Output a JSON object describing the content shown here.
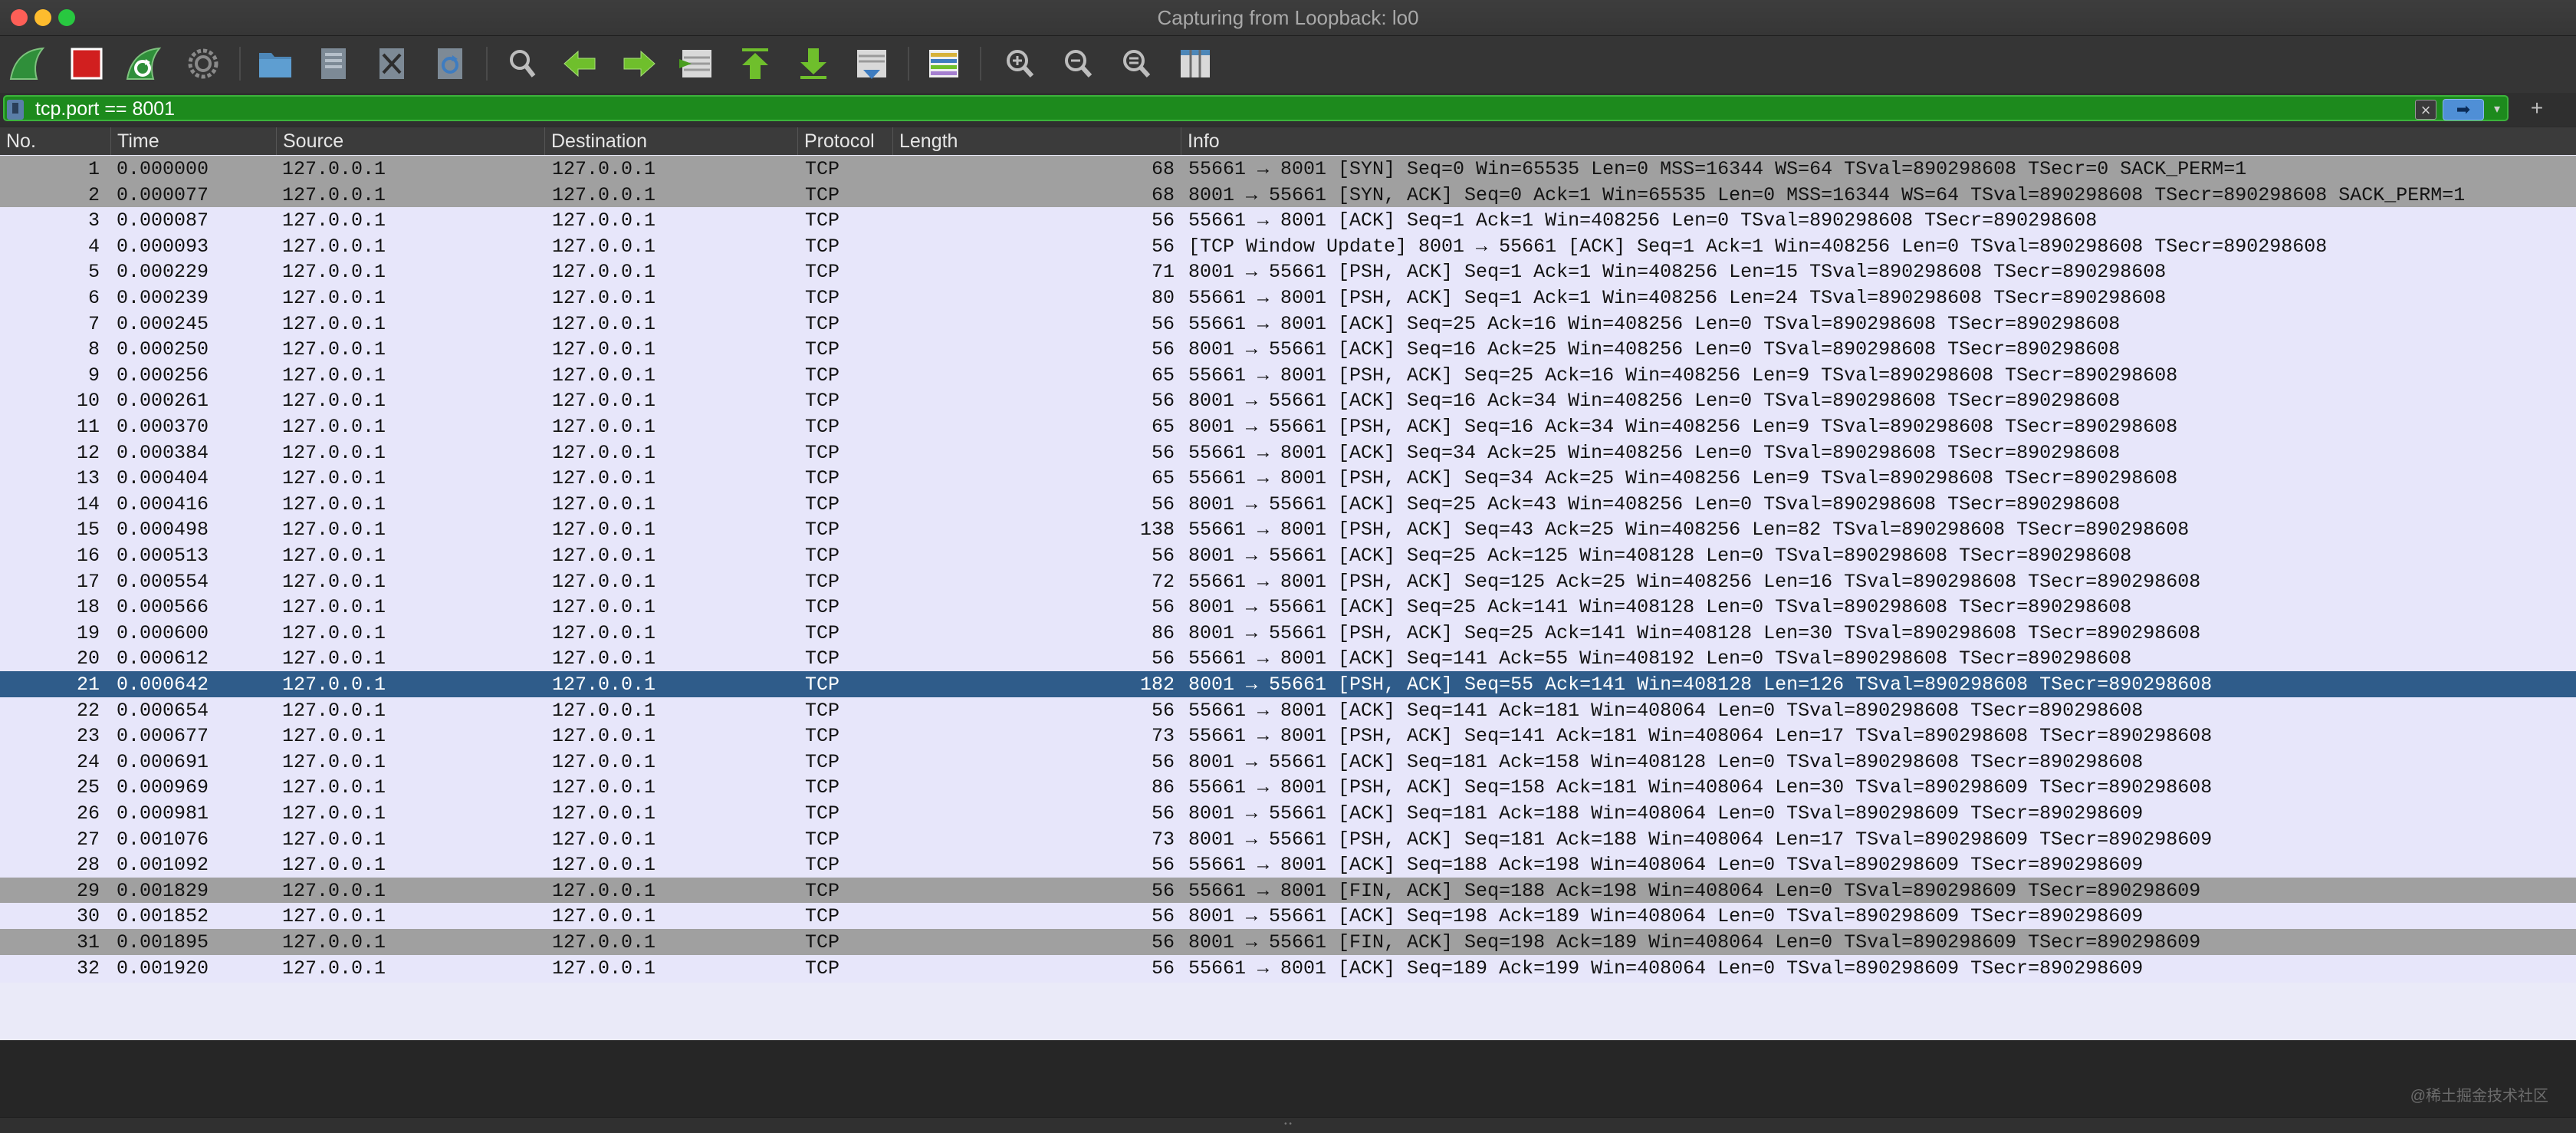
{
  "window": {
    "title": "Capturing from Loopback: lo0"
  },
  "toolbar": {
    "icons": [
      "shark-fin-start-icon",
      "stop-square-icon",
      "restart-fin-icon",
      "gear-icon",
      "folder-open-icon",
      "file-save-icon",
      "file-close-icon",
      "reload-icon",
      "find-icon",
      "back-arrow-icon",
      "forward-arrow-icon",
      "go-to-packet-icon",
      "first-packet-icon",
      "last-packet-icon",
      "autoscroll-icon",
      "colorize-icon",
      "zoom-in-icon",
      "zoom-out-icon",
      "zoom-reset-icon",
      "resize-columns-icon"
    ]
  },
  "filter": {
    "value": "tcp.port == 8001"
  },
  "columns": {
    "no": "No.",
    "time": "Time",
    "source": "Source",
    "destination": "Destination",
    "protocol": "Protocol",
    "length": "Length",
    "info": "Info"
  },
  "packets": [
    {
      "no": "1",
      "time": "0.000000",
      "src": "127.0.0.1",
      "dst": "127.0.0.1",
      "proto": "TCP",
      "len": "68",
      "info": "55661 → 8001 [SYN] Seq=0 Win=65535 Len=0 MSS=16344 WS=64 TSval=890298608 TSecr=0 SACK_PERM=1",
      "style": "gray"
    },
    {
      "no": "2",
      "time": "0.000077",
      "src": "127.0.0.1",
      "dst": "127.0.0.1",
      "proto": "TCP",
      "len": "68",
      "info": "8001 → 55661 [SYN, ACK] Seq=0 Ack=1 Win=65535 Len=0 MSS=16344 WS=64 TSval=890298608 TSecr=890298608 SACK_PERM=1",
      "style": "gray"
    },
    {
      "no": "3",
      "time": "0.000087",
      "src": "127.0.0.1",
      "dst": "127.0.0.1",
      "proto": "TCP",
      "len": "56",
      "info": "55661 → 8001 [ACK] Seq=1 Ack=1 Win=408256 Len=0 TSval=890298608 TSecr=890298608",
      "style": "normal"
    },
    {
      "no": "4",
      "time": "0.000093",
      "src": "127.0.0.1",
      "dst": "127.0.0.1",
      "proto": "TCP",
      "len": "56",
      "info": "[TCP Window Update] 8001 → 55661 [ACK] Seq=1 Ack=1 Win=408256 Len=0 TSval=890298608 TSecr=890298608",
      "style": "normal"
    },
    {
      "no": "5",
      "time": "0.000229",
      "src": "127.0.0.1",
      "dst": "127.0.0.1",
      "proto": "TCP",
      "len": "71",
      "info": "8001 → 55661 [PSH, ACK] Seq=1 Ack=1 Win=408256 Len=15 TSval=890298608 TSecr=890298608",
      "style": "normal"
    },
    {
      "no": "6",
      "time": "0.000239",
      "src": "127.0.0.1",
      "dst": "127.0.0.1",
      "proto": "TCP",
      "len": "80",
      "info": "55661 → 8001 [PSH, ACK] Seq=1 Ack=1 Win=408256 Len=24 TSval=890298608 TSecr=890298608",
      "style": "normal"
    },
    {
      "no": "7",
      "time": "0.000245",
      "src": "127.0.0.1",
      "dst": "127.0.0.1",
      "proto": "TCP",
      "len": "56",
      "info": "55661 → 8001 [ACK] Seq=25 Ack=16 Win=408256 Len=0 TSval=890298608 TSecr=890298608",
      "style": "normal"
    },
    {
      "no": "8",
      "time": "0.000250",
      "src": "127.0.0.1",
      "dst": "127.0.0.1",
      "proto": "TCP",
      "len": "56",
      "info": "8001 → 55661 [ACK] Seq=16 Ack=25 Win=408256 Len=0 TSval=890298608 TSecr=890298608",
      "style": "normal"
    },
    {
      "no": "9",
      "time": "0.000256",
      "src": "127.0.0.1",
      "dst": "127.0.0.1",
      "proto": "TCP",
      "len": "65",
      "info": "55661 → 8001 [PSH, ACK] Seq=25 Ack=16 Win=408256 Len=9 TSval=890298608 TSecr=890298608",
      "style": "normal"
    },
    {
      "no": "10",
      "time": "0.000261",
      "src": "127.0.0.1",
      "dst": "127.0.0.1",
      "proto": "TCP",
      "len": "56",
      "info": "8001 → 55661 [ACK] Seq=16 Ack=34 Win=408256 Len=0 TSval=890298608 TSecr=890298608",
      "style": "normal"
    },
    {
      "no": "11",
      "time": "0.000370",
      "src": "127.0.0.1",
      "dst": "127.0.0.1",
      "proto": "TCP",
      "len": "65",
      "info": "8001 → 55661 [PSH, ACK] Seq=16 Ack=34 Win=408256 Len=9 TSval=890298608 TSecr=890298608",
      "style": "normal"
    },
    {
      "no": "12",
      "time": "0.000384",
      "src": "127.0.0.1",
      "dst": "127.0.0.1",
      "proto": "TCP",
      "len": "56",
      "info": "55661 → 8001 [ACK] Seq=34 Ack=25 Win=408256 Len=0 TSval=890298608 TSecr=890298608",
      "style": "normal"
    },
    {
      "no": "13",
      "time": "0.000404",
      "src": "127.0.0.1",
      "dst": "127.0.0.1",
      "proto": "TCP",
      "len": "65",
      "info": "55661 → 8001 [PSH, ACK] Seq=34 Ack=25 Win=408256 Len=9 TSval=890298608 TSecr=890298608",
      "style": "normal"
    },
    {
      "no": "14",
      "time": "0.000416",
      "src": "127.0.0.1",
      "dst": "127.0.0.1",
      "proto": "TCP",
      "len": "56",
      "info": "8001 → 55661 [ACK] Seq=25 Ack=43 Win=408256 Len=0 TSval=890298608 TSecr=890298608",
      "style": "normal"
    },
    {
      "no": "15",
      "time": "0.000498",
      "src": "127.0.0.1",
      "dst": "127.0.0.1",
      "proto": "TCP",
      "len": "138",
      "info": "55661 → 8001 [PSH, ACK] Seq=43 Ack=25 Win=408256 Len=82 TSval=890298608 TSecr=890298608",
      "style": "normal"
    },
    {
      "no": "16",
      "time": "0.000513",
      "src": "127.0.0.1",
      "dst": "127.0.0.1",
      "proto": "TCP",
      "len": "56",
      "info": "8001 → 55661 [ACK] Seq=25 Ack=125 Win=408128 Len=0 TSval=890298608 TSecr=890298608",
      "style": "normal"
    },
    {
      "no": "17",
      "time": "0.000554",
      "src": "127.0.0.1",
      "dst": "127.0.0.1",
      "proto": "TCP",
      "len": "72",
      "info": "55661 → 8001 [PSH, ACK] Seq=125 Ack=25 Win=408256 Len=16 TSval=890298608 TSecr=890298608",
      "style": "normal"
    },
    {
      "no": "18",
      "time": "0.000566",
      "src": "127.0.0.1",
      "dst": "127.0.0.1",
      "proto": "TCP",
      "len": "56",
      "info": "8001 → 55661 [ACK] Seq=25 Ack=141 Win=408128 Len=0 TSval=890298608 TSecr=890298608",
      "style": "normal"
    },
    {
      "no": "19",
      "time": "0.000600",
      "src": "127.0.0.1",
      "dst": "127.0.0.1",
      "proto": "TCP",
      "len": "86",
      "info": "8001 → 55661 [PSH, ACK] Seq=25 Ack=141 Win=408128 Len=30 TSval=890298608 TSecr=890298608",
      "style": "normal"
    },
    {
      "no": "20",
      "time": "0.000612",
      "src": "127.0.0.1",
      "dst": "127.0.0.1",
      "proto": "TCP",
      "len": "56",
      "info": "55661 → 8001 [ACK] Seq=141 Ack=55 Win=408192 Len=0 TSval=890298608 TSecr=890298608",
      "style": "normal"
    },
    {
      "no": "21",
      "time": "0.000642",
      "src": "127.0.0.1",
      "dst": "127.0.0.1",
      "proto": "TCP",
      "len": "182",
      "info": "8001 → 55661 [PSH, ACK] Seq=55 Ack=141 Win=408128 Len=126 TSval=890298608 TSecr=890298608",
      "style": "selected"
    },
    {
      "no": "22",
      "time": "0.000654",
      "src": "127.0.0.1",
      "dst": "127.0.0.1",
      "proto": "TCP",
      "len": "56",
      "info": "55661 → 8001 [ACK] Seq=141 Ack=181 Win=408064 Len=0 TSval=890298608 TSecr=890298608",
      "style": "normal"
    },
    {
      "no": "23",
      "time": "0.000677",
      "src": "127.0.0.1",
      "dst": "127.0.0.1",
      "proto": "TCP",
      "len": "73",
      "info": "55661 → 8001 [PSH, ACK] Seq=141 Ack=181 Win=408064 Len=17 TSval=890298608 TSecr=890298608",
      "style": "normal"
    },
    {
      "no": "24",
      "time": "0.000691",
      "src": "127.0.0.1",
      "dst": "127.0.0.1",
      "proto": "TCP",
      "len": "56",
      "info": "8001 → 55661 [ACK] Seq=181 Ack=158 Win=408128 Len=0 TSval=890298608 TSecr=890298608",
      "style": "normal"
    },
    {
      "no": "25",
      "time": "0.000969",
      "src": "127.0.0.1",
      "dst": "127.0.0.1",
      "proto": "TCP",
      "len": "86",
      "info": "55661 → 8001 [PSH, ACK] Seq=158 Ack=181 Win=408064 Len=30 TSval=890298609 TSecr=890298608",
      "style": "normal"
    },
    {
      "no": "26",
      "time": "0.000981",
      "src": "127.0.0.1",
      "dst": "127.0.0.1",
      "proto": "TCP",
      "len": "56",
      "info": "8001 → 55661 [ACK] Seq=181 Ack=188 Win=408064 Len=0 TSval=890298609 TSecr=890298609",
      "style": "normal"
    },
    {
      "no": "27",
      "time": "0.001076",
      "src": "127.0.0.1",
      "dst": "127.0.0.1",
      "proto": "TCP",
      "len": "73",
      "info": "8001 → 55661 [PSH, ACK] Seq=181 Ack=188 Win=408064 Len=17 TSval=890298609 TSecr=890298609",
      "style": "normal"
    },
    {
      "no": "28",
      "time": "0.001092",
      "src": "127.0.0.1",
      "dst": "127.0.0.1",
      "proto": "TCP",
      "len": "56",
      "info": "55661 → 8001 [ACK] Seq=188 Ack=198 Win=408064 Len=0 TSval=890298609 TSecr=890298609",
      "style": "normal"
    },
    {
      "no": "29",
      "time": "0.001829",
      "src": "127.0.0.1",
      "dst": "127.0.0.1",
      "proto": "TCP",
      "len": "56",
      "info": "55661 → 8001 [FIN, ACK] Seq=188 Ack=198 Win=408064 Len=0 TSval=890298609 TSecr=890298609",
      "style": "gray"
    },
    {
      "no": "30",
      "time": "0.001852",
      "src": "127.0.0.1",
      "dst": "127.0.0.1",
      "proto": "TCP",
      "len": "56",
      "info": "8001 → 55661 [ACK] Seq=198 Ack=189 Win=408064 Len=0 TSval=890298609 TSecr=890298609",
      "style": "normal"
    },
    {
      "no": "31",
      "time": "0.001895",
      "src": "127.0.0.1",
      "dst": "127.0.0.1",
      "proto": "TCP",
      "len": "56",
      "info": "8001 → 55661 [FIN, ACK] Seq=198 Ack=189 Win=408064 Len=0 TSval=890298609 TSecr=890298609",
      "style": "gray"
    },
    {
      "no": "32",
      "time": "0.001920",
      "src": "127.0.0.1",
      "dst": "127.0.0.1",
      "proto": "TCP",
      "len": "56",
      "info": "55661 → 8001 [ACK] Seq=189 Ack=199 Win=408064 Len=0 TSval=890298609 TSecr=890298609",
      "style": "normal"
    }
  ],
  "row_colors": {
    "normal": "#e7e6fa",
    "gray": "#a0a0a0",
    "selected": "#2f5c8a"
  },
  "colors": {
    "filter_valid": "#1d8a1d",
    "toolbar_bg": "#353535"
  },
  "watermark": "@稀土掘金技术社区"
}
